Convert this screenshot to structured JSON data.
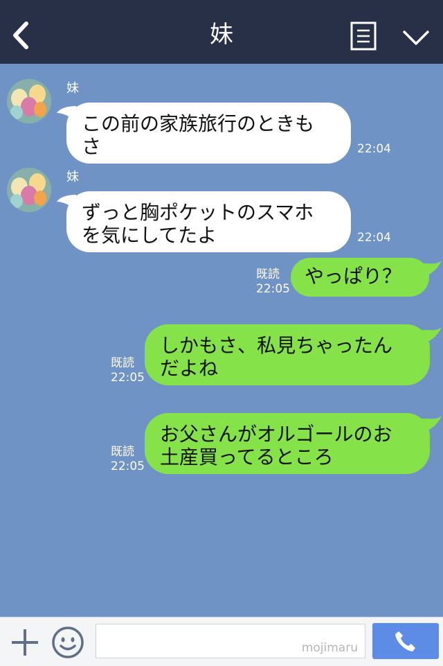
{
  "header": {
    "title": "妹"
  },
  "messages": [
    {
      "sender": "妹",
      "line1": "この前の家族旅行のときも",
      "line2": "さ",
      "time": "22:04"
    },
    {
      "sender": "妹",
      "line1": "ずっと胸ポケットのスマホ",
      "line2": "を気にしてたよ",
      "time": "22:04"
    },
    {
      "text": "やっぱり？",
      "read": "既読",
      "time": "22:05"
    },
    {
      "line1": "しかもさ、私見ちゃったん",
      "line2": "だよね",
      "read": "既読",
      "time": "22:05"
    },
    {
      "line1": "お父さんがオルゴールのお",
      "line2": "土産買ってるところ",
      "read": "既読",
      "time": "22:05"
    }
  ],
  "footer": {
    "watermark": "mojimaru"
  },
  "colors": {
    "header": "#273047",
    "chat_bg": "#6f93c4",
    "incoming": "#ffffff",
    "outgoing": "#85e249",
    "call": "#5c8ce6"
  },
  "icons": [
    "back-icon",
    "menu-icon",
    "chevron-down-icon",
    "plus-icon",
    "smile-icon",
    "phone-icon"
  ]
}
